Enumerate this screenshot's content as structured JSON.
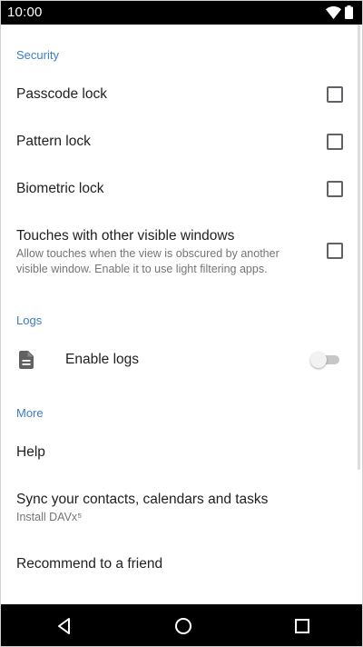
{
  "status_bar": {
    "time": "10:00",
    "icons": [
      "wifi-icon",
      "battery-icon"
    ]
  },
  "sections": {
    "security": {
      "header": "Security",
      "passcode_lock": {
        "title": "Passcode lock",
        "checked": false
      },
      "pattern_lock": {
        "title": "Pattern lock",
        "checked": false
      },
      "biometric_lock": {
        "title": "Biometric lock",
        "checked": false
      },
      "touches": {
        "title": "Touches with other visible windows",
        "summary": "Allow touches when the view is obscured by another visible window. Enable it to use light filtering apps.",
        "checked": false
      }
    },
    "logs": {
      "header": "Logs",
      "enable_logs": {
        "title": "Enable logs",
        "icon": "document-icon",
        "enabled": false
      }
    },
    "more": {
      "header": "More",
      "help": {
        "title": "Help"
      },
      "sync": {
        "title": "Sync your contacts, calendars and tasks",
        "summary": "Install DAVx⁵"
      },
      "recommend": {
        "title": "Recommend to a friend"
      }
    }
  },
  "nav_bar": {
    "icons": [
      "back-icon",
      "home-icon",
      "recents-icon"
    ]
  },
  "colors": {
    "accent": "#3d7cc7",
    "status_bar": "#000000",
    "nav_bar": "#000000",
    "summary_text": "#757575"
  }
}
